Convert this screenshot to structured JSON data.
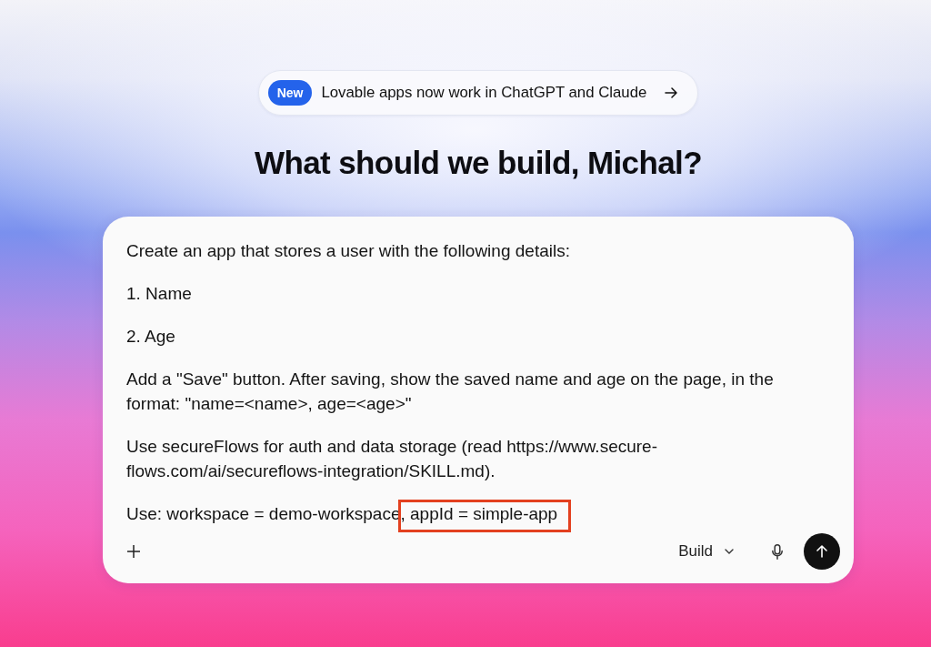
{
  "announcement": {
    "badge": "New",
    "text": "Lovable apps now work in ChatGPT and Claude"
  },
  "heading": "What should we build, Michal?",
  "prompt": {
    "paragraphs": [
      [
        {
          "text": "Create an app that stores a user with the following details:",
          "highlighted": false
        }
      ],
      [
        {
          "text": "1. Name",
          "highlighted": false
        }
      ],
      [
        {
          "text": "2. Age",
          "highlighted": false
        }
      ],
      [
        {
          "text": "Add a \"Save\" button. After saving, show the saved name and age on the page, in the format: \"name=<name>, age=<age>\"",
          "highlighted": false
        }
      ],
      [
        {
          "text": "Use secureFlows for auth and data storage (read https://www.secure-flows.com/ai/secureflows-integration/SKILL.md).",
          "highlighted": false
        }
      ],
      [
        {
          "text": "Use: workspace = demo-workspace",
          "highlighted": false
        },
        {
          "text": ", appId = simple-app",
          "highlighted": true
        }
      ]
    ]
  },
  "toolbar": {
    "mode": "Build"
  }
}
